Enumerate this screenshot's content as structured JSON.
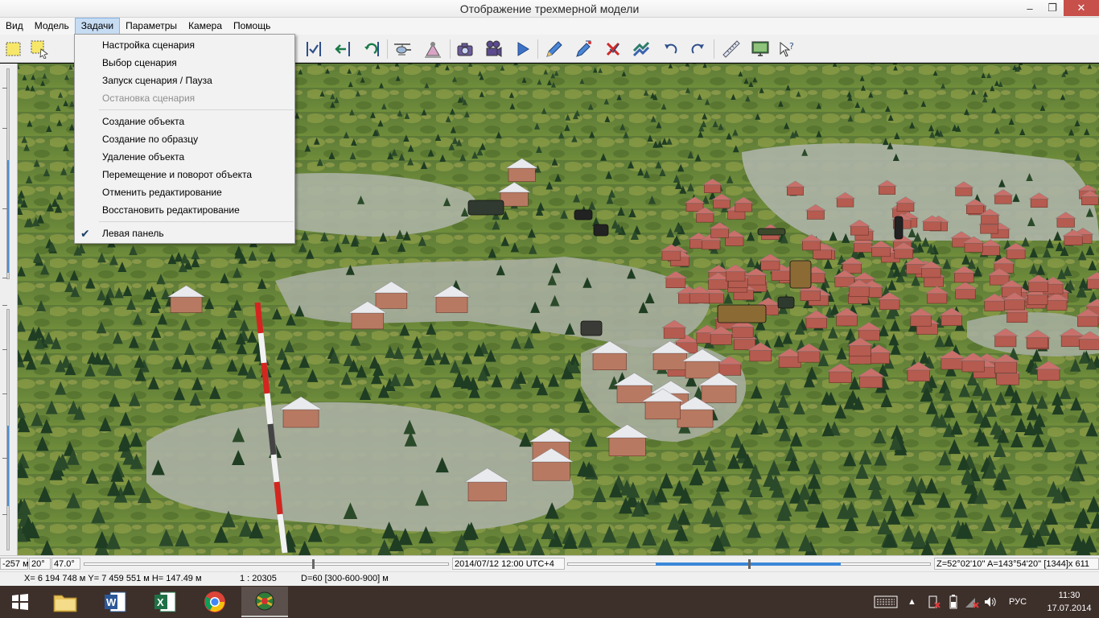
{
  "window": {
    "title": "Отображение трехмерной модели"
  },
  "menu": {
    "items": [
      "Вид",
      "Модель",
      "Задачи",
      "Параметры",
      "Камера",
      "Помощь"
    ],
    "active": "Задачи"
  },
  "dropdown": {
    "items": [
      {
        "label": "Настройка сценария",
        "enabled": true
      },
      {
        "label": "Выбор сценария",
        "enabled": true
      },
      {
        "label": "Запуск сценария / Пауза",
        "enabled": true
      },
      {
        "label": "Остановка сценария",
        "enabled": false
      },
      {
        "label": "Создание объекта",
        "enabled": true
      },
      {
        "label": "Создание по образцу",
        "enabled": true
      },
      {
        "label": "Удаление объекта",
        "enabled": true
      },
      {
        "label": "Перемещение и поворот объекта",
        "enabled": true
      },
      {
        "label": "Отменить редактирование",
        "enabled": true
      },
      {
        "label": "Восстановить редактирование",
        "enabled": true
      },
      {
        "label": "Левая панель",
        "enabled": true,
        "checked": true
      }
    ]
  },
  "status": {
    "height": "-257 м",
    "angle1": "20°",
    "angle2": "47.0°",
    "datetime": "2014/07/12  12:00  UTC+4",
    "orientation": "Z=52°02'10''  A=143°54'20''  [1344]x 611",
    "coords": "X= 6 194 748 м  Y= 7 459 551 м  H= 147.49 м",
    "scale": "1 : 20305",
    "distance": "D=60 [300-600-900] м"
  },
  "tray": {
    "language": "РУС",
    "time": "11:30",
    "date": "17.07.2014"
  },
  "colors": {
    "accent": "#3a87d8",
    "menu_highlight": "#c6dcf3",
    "taskbar": "#3d2f2a",
    "close_button": "#c7504b"
  },
  "icons": [
    "select-icon",
    "select-region-icon",
    "helicopter-icon",
    "camera-icon",
    "movie-camera-icon",
    "play-icon",
    "pencil-icon",
    "undo-icon",
    "redo-icon",
    "ruler-icon",
    "monitor-icon",
    "help-icon"
  ]
}
